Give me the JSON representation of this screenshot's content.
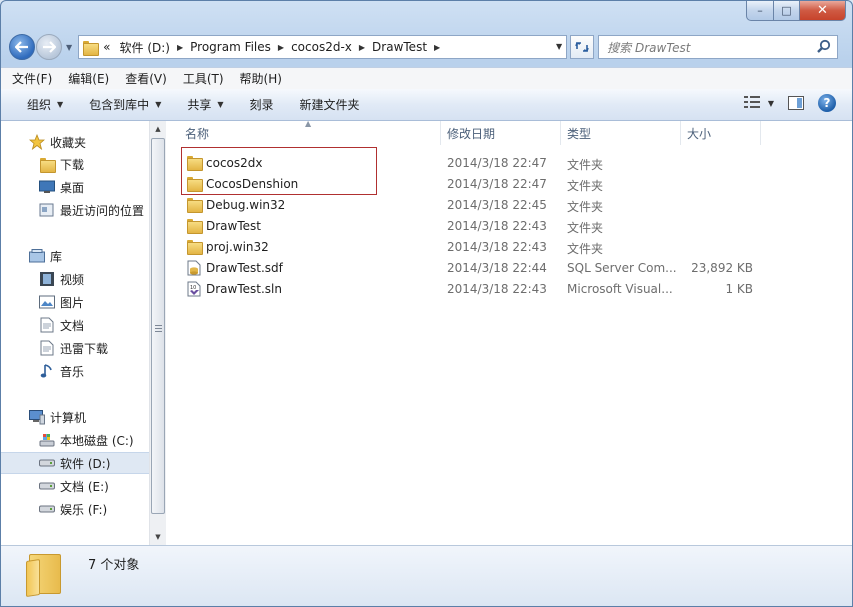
{
  "window": {
    "controls": {
      "minimize": "–",
      "maximize": "□",
      "close": "✕"
    }
  },
  "address_bar": {
    "overflow": "«",
    "crumbs": [
      "软件 (D:)",
      "Program Files",
      "cocos2d-x",
      "DrawTest"
    ],
    "search_placeholder": "搜索 DrawTest"
  },
  "menu": [
    "文件(F)",
    "编辑(E)",
    "查看(V)",
    "工具(T)",
    "帮助(H)"
  ],
  "commands": {
    "organize": "组织",
    "include_in_library": "包含到库中",
    "share": "共享",
    "burn": "刻录",
    "new_folder": "新建文件夹"
  },
  "nav_pane": {
    "favorites": {
      "label": "收藏夹",
      "items": [
        "下载",
        "桌面",
        "最近访问的位置"
      ]
    },
    "libraries": {
      "label": "库",
      "items": [
        "视频",
        "图片",
        "文档",
        "迅雷下载",
        "音乐"
      ]
    },
    "computer": {
      "label": "计算机",
      "items": [
        "本地磁盘 (C:)",
        "软件 (D:)",
        "文档 (E:)",
        "娱乐 (F:)"
      ],
      "selected": "软件 (D:)"
    }
  },
  "columns": [
    "名称",
    "修改日期",
    "类型",
    "大小"
  ],
  "files": [
    {
      "name": "cocos2dx",
      "date": "2014/3/18 22:47",
      "type": "文件夹",
      "size": "",
      "icon": "folder-icon"
    },
    {
      "name": "CocosDenshion",
      "date": "2014/3/18 22:47",
      "type": "文件夹",
      "size": "",
      "icon": "folder-icon"
    },
    {
      "name": "Debug.win32",
      "date": "2014/3/18 22:45",
      "type": "文件夹",
      "size": "",
      "icon": "folder-icon"
    },
    {
      "name": "DrawTest",
      "date": "2014/3/18 22:43",
      "type": "文件夹",
      "size": "",
      "icon": "folder-icon"
    },
    {
      "name": "proj.win32",
      "date": "2014/3/18 22:43",
      "type": "文件夹",
      "size": "",
      "icon": "folder-icon"
    },
    {
      "name": "DrawTest.sdf",
      "date": "2014/3/18 22:44",
      "type": "SQL Server Com...",
      "size": "23,892 KB",
      "icon": "sdf-file-icon"
    },
    {
      "name": "DrawTest.sln",
      "date": "2014/3/18 22:43",
      "type": "Microsoft Visual...",
      "size": "1 KB",
      "icon": "sln-file-icon"
    }
  ],
  "status": {
    "count_text": "7 个对象"
  },
  "colors": {
    "highlight_box": "#b03030",
    "selected_nav": "#dfe8f3",
    "chrome": "#cfe0f3"
  }
}
